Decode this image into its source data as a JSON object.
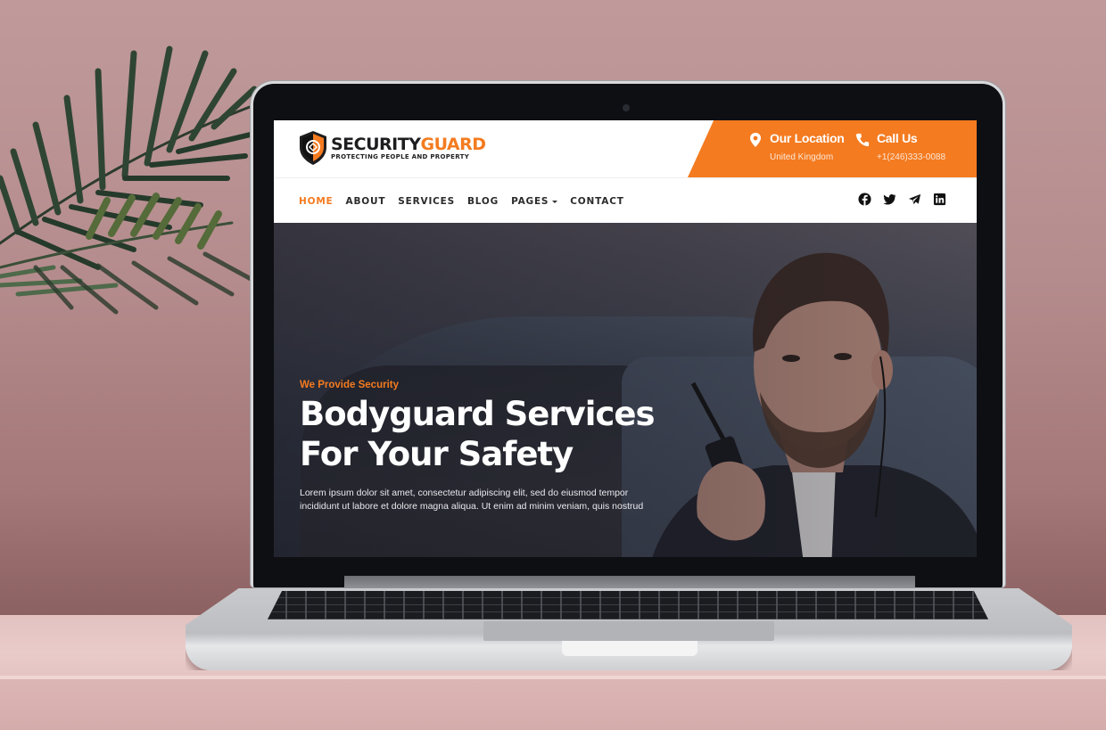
{
  "site": {
    "logo": {
      "brand_part1": "SECURITY",
      "brand_part2": "GUARD",
      "tagline": "PROTECTING PEOPLE AND PROPERTY",
      "icon": "shield-icon"
    },
    "contact": {
      "location": {
        "icon": "map-pin-icon",
        "title": "Our Location",
        "value": "United Kingdom"
      },
      "call": {
        "icon": "phone-icon",
        "title": "Call Us",
        "value": "+1(246)333-0088"
      }
    },
    "nav": {
      "items": [
        {
          "label": "HOME",
          "active": true
        },
        {
          "label": "ABOUT",
          "active": false
        },
        {
          "label": "SERVICES",
          "active": false
        },
        {
          "label": "BLOG",
          "active": false
        },
        {
          "label": "PAGES",
          "active": false,
          "has_dropdown": true
        },
        {
          "label": "CONTACT",
          "active": false
        }
      ]
    },
    "socials": [
      {
        "name": "facebook",
        "icon": "facebook-icon"
      },
      {
        "name": "twitter",
        "icon": "twitter-icon"
      },
      {
        "name": "telegram",
        "icon": "telegram-icon"
      },
      {
        "name": "linkedin",
        "icon": "linkedin-icon"
      }
    ],
    "hero": {
      "eyebrow": "We Provide Security",
      "headline": "Bodyguard Services For Your Safety",
      "lead": "Lorem ipsum dolor sit amet, consectetur adipiscing elit, sed do eiusmod tempor incididunt ut labore et dolore magna aliqua. Ut enim ad minim veniam, quis nostrud"
    },
    "colors": {
      "accent": "#f47b20",
      "text_dark": "#1d1d1f",
      "hero_text": "#ffffff"
    }
  }
}
